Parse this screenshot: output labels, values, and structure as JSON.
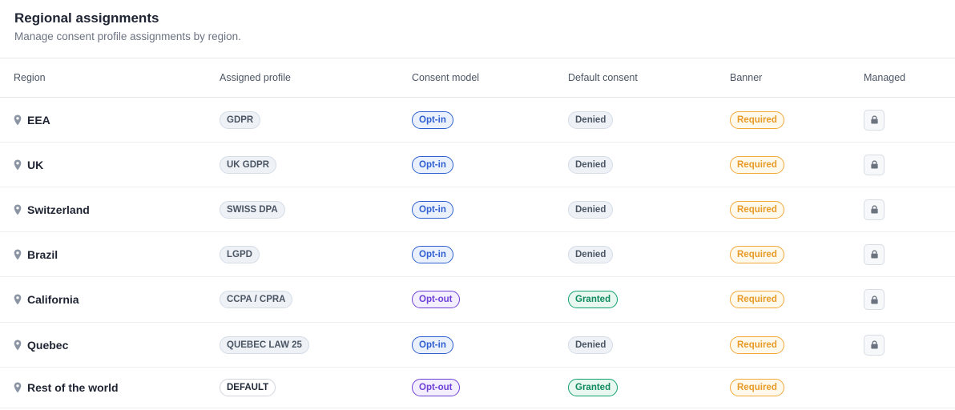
{
  "header": {
    "title": "Regional assignments",
    "subtitle": "Manage consent profile assignments by region."
  },
  "columns": {
    "region": "Region",
    "profile": "Assigned profile",
    "model": "Consent model",
    "consent": "Default consent",
    "banner": "Banner",
    "managed": "Managed"
  },
  "rows": [
    {
      "region": "EEA",
      "profile": "GDPR",
      "model": "Opt-in",
      "consent": "Denied",
      "banner": "Required",
      "managed": true
    },
    {
      "region": "UK",
      "profile": "UK GDPR",
      "model": "Opt-in",
      "consent": "Denied",
      "banner": "Required",
      "managed": true
    },
    {
      "region": "Switzerland",
      "profile": "SWISS DPA",
      "model": "Opt-in",
      "consent": "Denied",
      "banner": "Required",
      "managed": true
    },
    {
      "region": "Brazil",
      "profile": "LGPD",
      "model": "Opt-in",
      "consent": "Denied",
      "banner": "Required",
      "managed": true
    },
    {
      "region": "California",
      "profile": "CCPA / CPRA",
      "model": "Opt-out",
      "consent": "Granted",
      "banner": "Required",
      "managed": true
    },
    {
      "region": "Quebec",
      "profile": "QUEBEC LAW 25",
      "model": "Opt-in",
      "consent": "Denied",
      "banner": "Required",
      "managed": true
    },
    {
      "region": "Rest of the world",
      "profile": "DEFAULT",
      "model": "Opt-out",
      "consent": "Granted",
      "banner": "Required",
      "managed": false
    }
  ]
}
